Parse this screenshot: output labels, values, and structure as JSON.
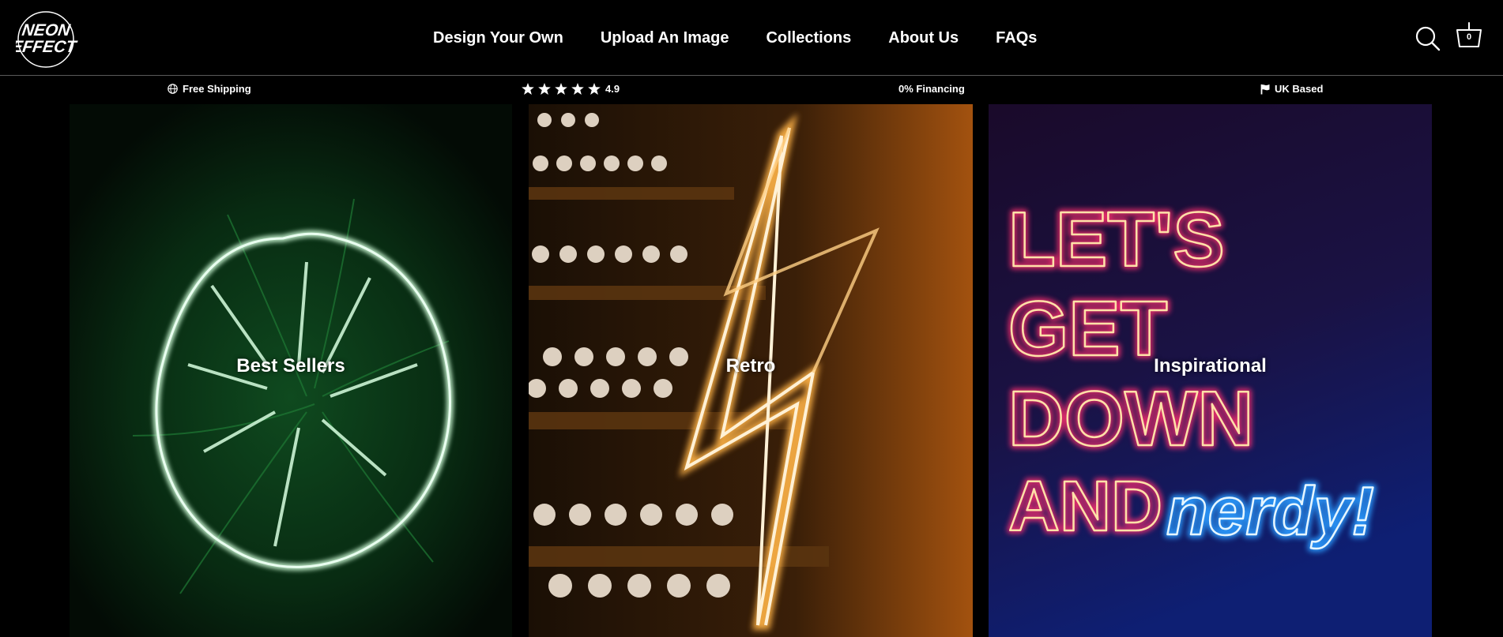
{
  "brand": {
    "logo_line1": "NEON",
    "logo_line2": "EFFECT"
  },
  "nav": {
    "items": [
      {
        "label": "Design Your Own"
      },
      {
        "label": "Upload An Image"
      },
      {
        "label": "Collections"
      },
      {
        "label": "About Us"
      },
      {
        "label": "FAQs"
      }
    ]
  },
  "header": {
    "search_icon": "search-icon",
    "cart_icon": "cart-icon",
    "cart_count": "0"
  },
  "usp": {
    "shipping": {
      "icon": "globe-icon",
      "label": "Free Shipping"
    },
    "rating": {
      "icon": "star-icon",
      "stars": 5,
      "value": "4.9"
    },
    "financing": {
      "label": "0% Financing"
    },
    "location": {
      "icon": "flag-icon",
      "label": "UK Based"
    }
  },
  "tiles": [
    {
      "label": "Best Sellers",
      "accent": "#3fbf5a"
    },
    {
      "label": "Retro",
      "accent": "#ffb347"
    },
    {
      "label": "Inspirational",
      "accent": "#ff2d6f"
    }
  ]
}
